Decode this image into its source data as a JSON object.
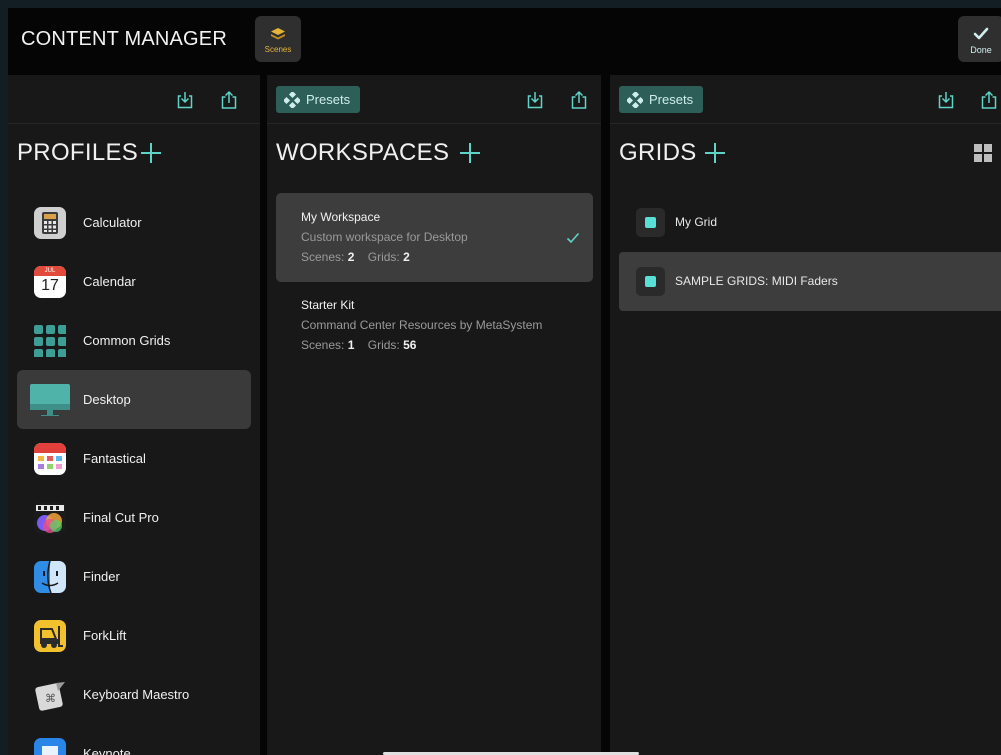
{
  "header": {
    "title": "CONTENT MANAGER",
    "scenes_label": "Scenes",
    "done_label": "Done"
  },
  "profiles": {
    "heading": "PROFILES",
    "items": [
      {
        "label": "Calculator",
        "icon": "calculator-icon"
      },
      {
        "label": "Calendar",
        "icon": "calendar-icon",
        "month": "JUL",
        "day": "17"
      },
      {
        "label": "Common Grids",
        "icon": "grid-icon"
      },
      {
        "label": "Desktop",
        "icon": "desktop-icon",
        "selected": true
      },
      {
        "label": "Fantastical",
        "icon": "fantastical-icon"
      },
      {
        "label": "Final Cut Pro",
        "icon": "final-cut-pro-icon"
      },
      {
        "label": "Finder",
        "icon": "finder-icon"
      },
      {
        "label": "ForkLift",
        "icon": "forklift-icon"
      },
      {
        "label": "Keyboard Maestro",
        "icon": "keyboard-maestro-icon"
      },
      {
        "label": "Keynote",
        "icon": "keynote-icon"
      }
    ]
  },
  "workspaces": {
    "presets_label": "Presets",
    "heading": "WORKSPACES",
    "items": [
      {
        "title": "My Workspace",
        "description": "Custom workspace for Desktop",
        "scenes_label": "Scenes:",
        "scenes": "2",
        "grids_label": "Grids:",
        "grids": "2",
        "selected": true
      },
      {
        "title": "Starter Kit",
        "description": "Command Center Resources by MetaSystem",
        "scenes_label": "Scenes:",
        "scenes": "1",
        "grids_label": "Grids:",
        "grids": "56",
        "selected": false
      }
    ]
  },
  "grids": {
    "presets_label": "Presets",
    "heading": "GRIDS",
    "items": [
      {
        "label": "My Grid",
        "selected": false
      },
      {
        "label": "SAMPLE GRIDS: MIDI Faders",
        "selected": true
      }
    ]
  },
  "colors": {
    "accent": "#5fd3c8",
    "presets_bg": "#2d5e57",
    "scenes_icon": "#e6b437"
  }
}
